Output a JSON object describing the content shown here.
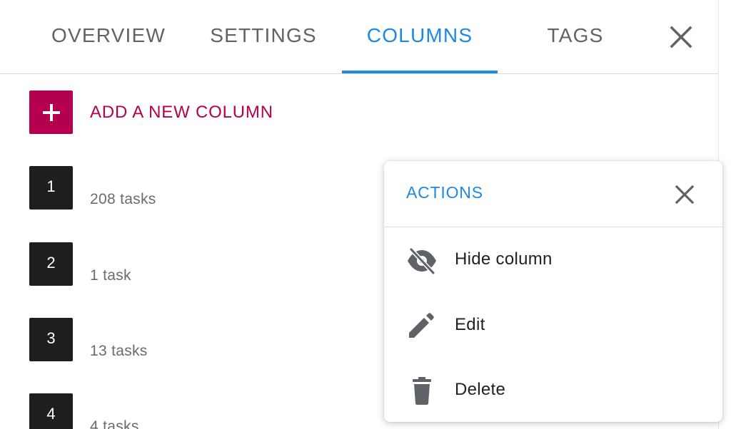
{
  "tabs": [
    {
      "label": "OVERVIEW",
      "active": false
    },
    {
      "label": "SETTINGS",
      "active": false
    },
    {
      "label": "COLUMNS",
      "active": true
    },
    {
      "label": "TAGS",
      "active": false
    }
  ],
  "add_column": {
    "label": "ADD A NEW COLUMN",
    "icon": "plus-icon"
  },
  "columns": [
    {
      "number": "1",
      "count": "208 tasks"
    },
    {
      "number": "2",
      "count": "1 task"
    },
    {
      "number": "3",
      "count": "13 tasks"
    },
    {
      "number": "4",
      "count": "4 tasks"
    }
  ],
  "actions_menu": {
    "title": "ACTIONS",
    "items": [
      {
        "label": "Hide column",
        "icon": "eye-off-icon"
      },
      {
        "label": "Edit",
        "icon": "pencil-icon"
      },
      {
        "label": "Delete",
        "icon": "trash-icon"
      }
    ]
  },
  "colors": {
    "accent": "#1e88e5",
    "add_color": "#b5004f",
    "badge": "#1e1e1e"
  }
}
